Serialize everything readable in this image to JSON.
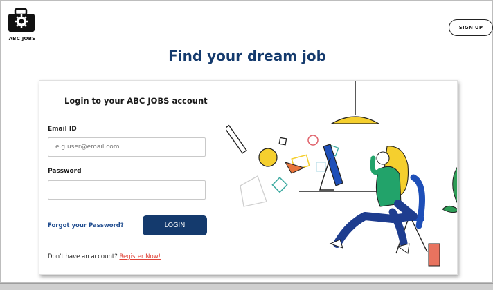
{
  "brand": {
    "name": "ABC JOBS"
  },
  "header": {
    "signup_label": "SIGN UP"
  },
  "hero": {
    "headline": "Find your dream job"
  },
  "login": {
    "title": "Login to your ABC JOBS account",
    "email_label": "Email ID",
    "email_placeholder": "e.g user@email.com",
    "email_value": "",
    "password_label": "Password",
    "password_value": "",
    "forgot_label": "Forgot your Password?",
    "login_label": "LOGIN",
    "register_prompt": "Don't have an account?",
    "register_link": "Register Now!"
  },
  "icons": {
    "logo": "briefcase-gear-icon",
    "illustration": "woman-at-computer-illustration"
  },
  "colors": {
    "headline": "#143a6d",
    "login_button": "#143a6d",
    "forgot_link": "#1f4c8f",
    "register_link": "#e0453a"
  }
}
